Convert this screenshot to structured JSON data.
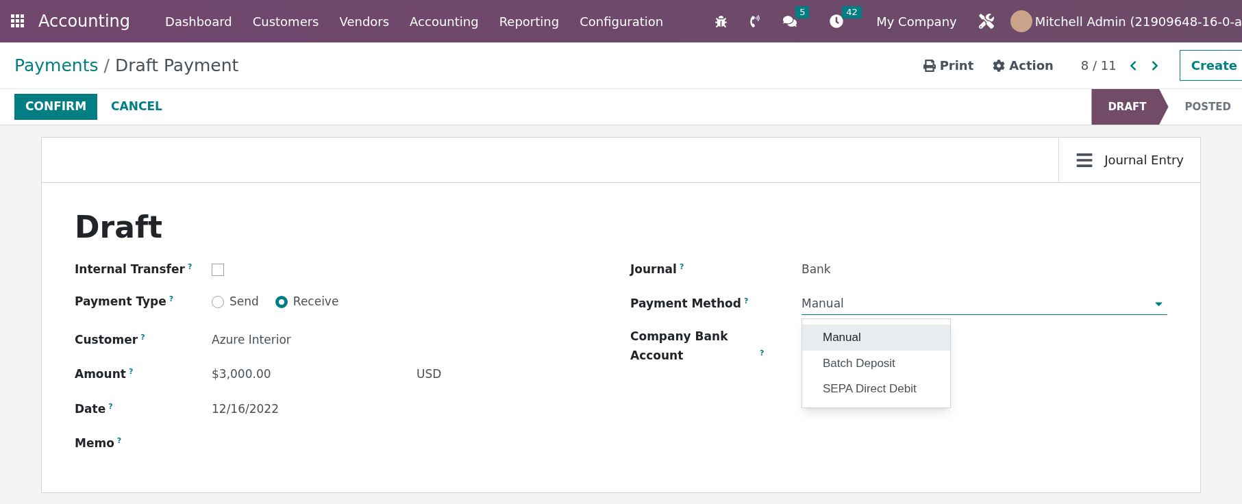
{
  "navbar": {
    "app_name": "Accounting",
    "menu": [
      "Dashboard",
      "Customers",
      "Vendors",
      "Accounting",
      "Reporting",
      "Configuration"
    ],
    "messages_count": "5",
    "activities_count": "42",
    "company": "My Company",
    "user": "Mitchell Admin (21909648-16-0-a"
  },
  "breadcrumb": {
    "parent": "Payments",
    "separator": "/",
    "current": "Draft Payment"
  },
  "actions": {
    "print": "Print",
    "action": "Action",
    "pager": "8 / 11",
    "create": "Create"
  },
  "buttons": [
    {
      "label": "CONFIRM",
      "kind": "primary"
    },
    {
      "label": "CANCEL",
      "kind": "link"
    }
  ],
  "status_steps": [
    {
      "label": "DRAFT",
      "selected": true
    },
    {
      "label": "POSTED",
      "selected": false
    }
  ],
  "smart_button": {
    "label": "Journal Entry"
  },
  "record_title": "Draft",
  "left_fields": [
    {
      "label": "Internal Transfer",
      "help": "?",
      "kind": "checkbox",
      "checked": false
    },
    {
      "label": "Payment Type",
      "help": "?",
      "kind": "radio",
      "options": [
        {
          "label": "Send",
          "selected": false
        },
        {
          "label": "Receive",
          "selected": true
        }
      ]
    },
    {
      "label": "Customer",
      "help": "?",
      "kind": "text",
      "value": "Azure Interior"
    },
    {
      "label": "Amount",
      "help": "?",
      "kind": "amount",
      "value": "$3,000.00",
      "currency": "USD"
    },
    {
      "label": "Date",
      "help": "?",
      "kind": "text",
      "value": "12/16/2022"
    },
    {
      "label": "Memo",
      "help": "?",
      "kind": "text"
    }
  ],
  "right_fields": [
    {
      "label": "Journal",
      "help": "?",
      "kind": "text",
      "value": "Bank"
    },
    {
      "label": "Payment Method",
      "help": "?",
      "kind": "select",
      "value": "Manual",
      "options": [
        {
          "label": "Manual",
          "selected": true
        },
        {
          "label": "Batch Deposit",
          "selected": false
        },
        {
          "label": "SEPA Direct Debit",
          "selected": false
        }
      ]
    },
    {
      "label": "Company Bank Account",
      "help": "?",
      "kind": "text"
    }
  ]
}
